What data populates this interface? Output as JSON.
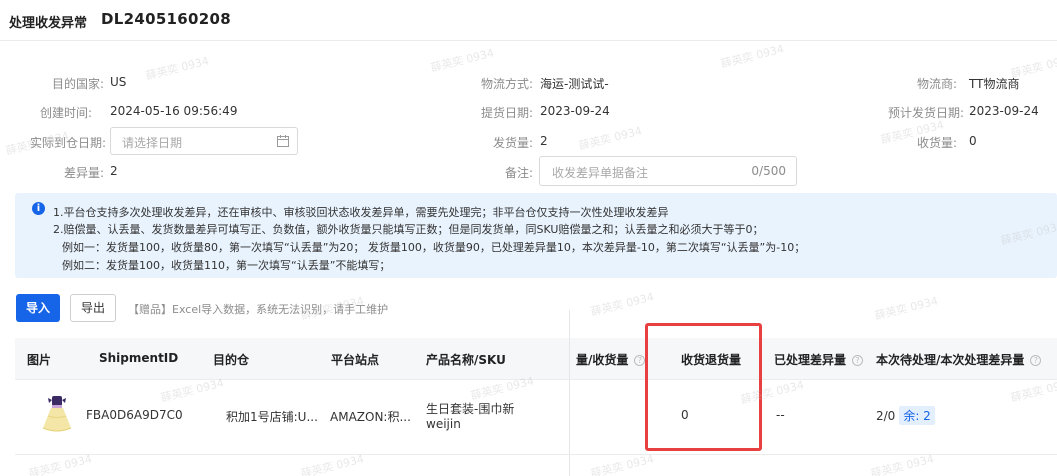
{
  "header": {
    "title": "处理收发异常",
    "doc_id": "DL2405160208"
  },
  "fields": {
    "dest_country_label": "目的国家:",
    "dest_country_value": "US",
    "ship_method_label": "物流方式:",
    "ship_method_value": "海运-测试试-",
    "carrier_label": "物流商:",
    "carrier_value": "TT物流商",
    "created_label": "创建时间:",
    "created_value": "2024-05-16 09:56:49",
    "pickup_date_label": "提货日期:",
    "pickup_date_value": "2023-09-24",
    "est_ship_label": "预计发货日期:",
    "est_ship_value": "2023-09-24",
    "arrival_label": "实际到仓日期:",
    "arrival_placeholder": "请选择日期",
    "shipped_qty_label": "发货量:",
    "shipped_qty_value": "2",
    "received_qty_label": "收货量:",
    "received_qty_value": "0",
    "diff_qty_label": "差异量:",
    "diff_qty_value": "2",
    "note_label": "备注:",
    "note_placeholder": "收发差异单据备注",
    "note_counter": "0/500"
  },
  "info": {
    "icon": "info-icon",
    "lines": [
      "1.平台仓支持多次处理收发差异，还在审核中、审核驳回状态收发差异单，需要先处理完；非平台仓仅支持一次性处理收发差异",
      "2.赔偿量、认丢量、发货数量差异可填写正、负数值，额外收货量只能填写正数；但是同发货单，同SKU赔偿量之和；认丢量之和必须大于等于0；",
      "例如一：发货量100，收货量80，第一次填写“认丢量”为20；  发货量100，收货量90，已处理差异量10，本次差异量-10，第二次填写“认丢量”为-10；",
      "例如二：发货量100，收货量110，第一次填写“认丢量”不能填写；"
    ]
  },
  "toolbar": {
    "import_label": "导入",
    "export_label": "导出",
    "hint": "【赠品】Excel导入数据，系统无法识别，请手工维护"
  },
  "table": {
    "headers": {
      "image": "图片",
      "shipment_id": "ShipmentID",
      "warehouse": "目的仓",
      "platform": "平台站点",
      "product": "产品名称/SKU",
      "received_partial": "量/收货量",
      "return_qty": "收货退货量",
      "processed_diff": "已处理差异量",
      "pending_diff": "本次待处理/本次处理差异量"
    },
    "rows": [
      {
        "shipment_id": "FBA0D6A9D7C0",
        "warehouse": "积加1号店铺:U...",
        "platform": "AMAZON:积...",
        "product_name": "生日套装-围巾新",
        "product_sku": "weijin",
        "return_qty": "0",
        "processed_diff": "--",
        "pending": "2/0",
        "remain_badge": "余: 2"
      }
    ]
  },
  "watermark": "薛英奕 0934",
  "colors": {
    "primary": "#1664e8",
    "info_bg": "#e9f3fe",
    "highlight": "#e84040"
  }
}
